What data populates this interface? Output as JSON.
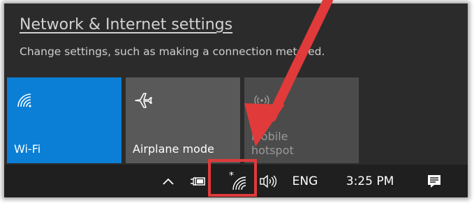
{
  "flyout": {
    "settings_link": "Network & Internet settings",
    "settings_desc": "Change settings, such as making a connection metered."
  },
  "tiles": [
    {
      "label": "Wi-Fi",
      "icon": "wifi-icon",
      "state": "on",
      "color": "#0b7fd6"
    },
    {
      "label": "Airplane mode",
      "icon": "airplane-icon",
      "state": "off",
      "color": "#595959"
    },
    {
      "label": "Mobile\nhotspot",
      "icon": "mobile-hotspot-icon",
      "state": "disabled",
      "color": "#4b4b4b"
    }
  ],
  "taskbar": {
    "language": "ENG",
    "time": "3:25 PM",
    "icons": [
      "chevron-up-icon",
      "power-plug-icon",
      "wifi-icon",
      "volume-icon",
      "action-center-icon"
    ]
  },
  "annotation": {
    "highlight_color": "#e03a3a",
    "arrow_color": "#e03a3a"
  }
}
